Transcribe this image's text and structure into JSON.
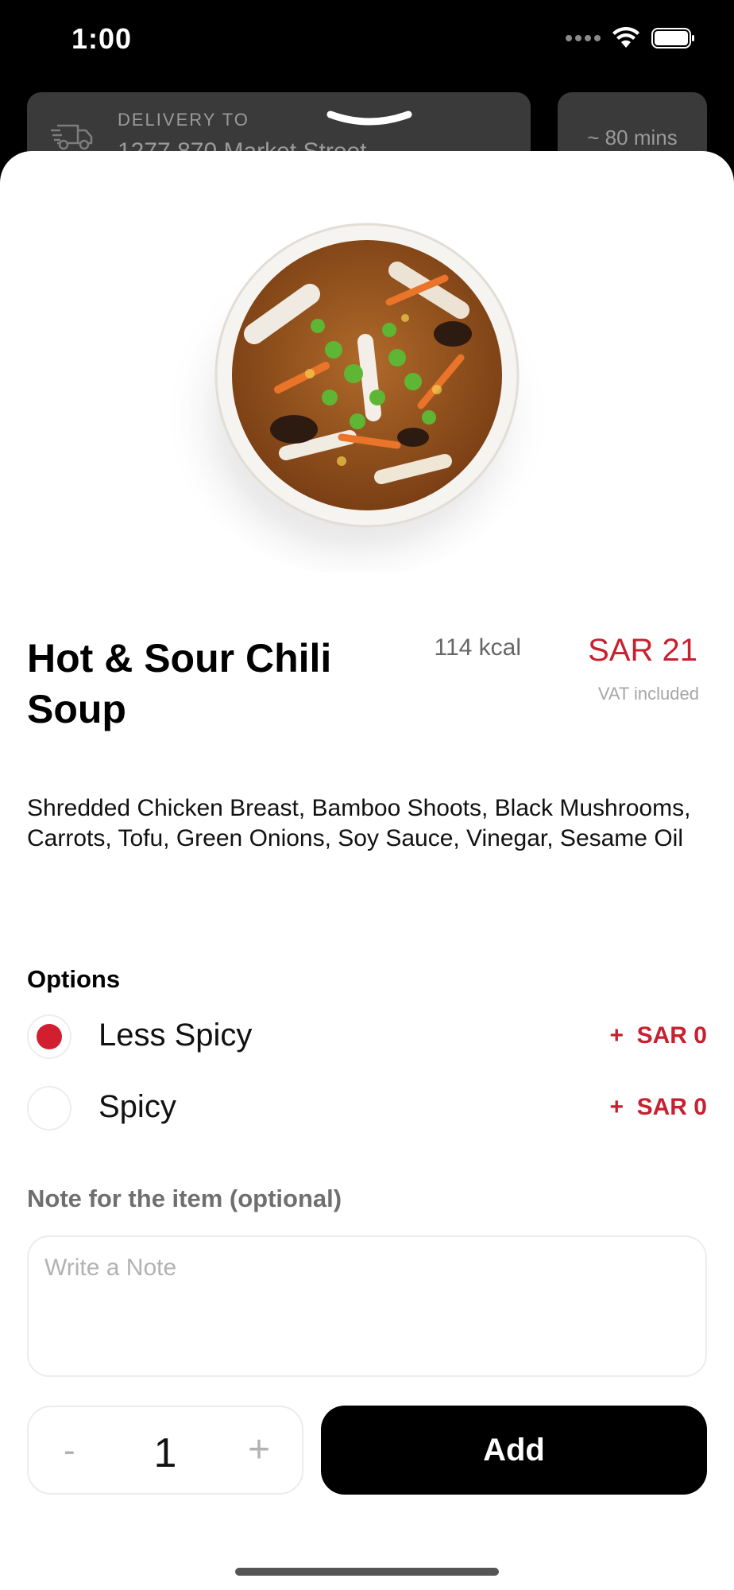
{
  "status_bar": {
    "time": "1:00",
    "icons": [
      "signal-dots-icon",
      "wifi-icon",
      "battery-icon"
    ]
  },
  "header": {
    "delivery_label": "DELIVERY TO",
    "delivery_address": "1277 870 Market Street",
    "eta": "~ 80 mins",
    "icons": [
      "truck-icon",
      "chevron-down-icon"
    ]
  },
  "item": {
    "image": "hot-sour-soup-bowl-image",
    "title": "Hot & Sour Chili Soup",
    "kcal": "114 kcal",
    "price": "SAR 21",
    "vat": "VAT included",
    "ingredients": "Shredded Chicken Breast, Bamboo Shoots, Black Mushrooms, Carrots, Tofu, Green Onions,  Soy Sauce, Vinegar,  Sesame Oil"
  },
  "options": {
    "title": "Options",
    "items": [
      {
        "label": "Less Spicy",
        "price": "+  SAR 0",
        "selected": true
      },
      {
        "label": "Spicy",
        "price": "+  SAR 0",
        "selected": false
      }
    ]
  },
  "note": {
    "label": "Note for the item (optional)",
    "placeholder": "Write a Note",
    "value": ""
  },
  "stepper": {
    "minus": "-",
    "quantity": "1",
    "plus": "+"
  },
  "add_button": {
    "label": "Add"
  },
  "colors": {
    "accent": "#c8202f",
    "radio_selected": "#d11f30",
    "button_bg": "#000000"
  }
}
